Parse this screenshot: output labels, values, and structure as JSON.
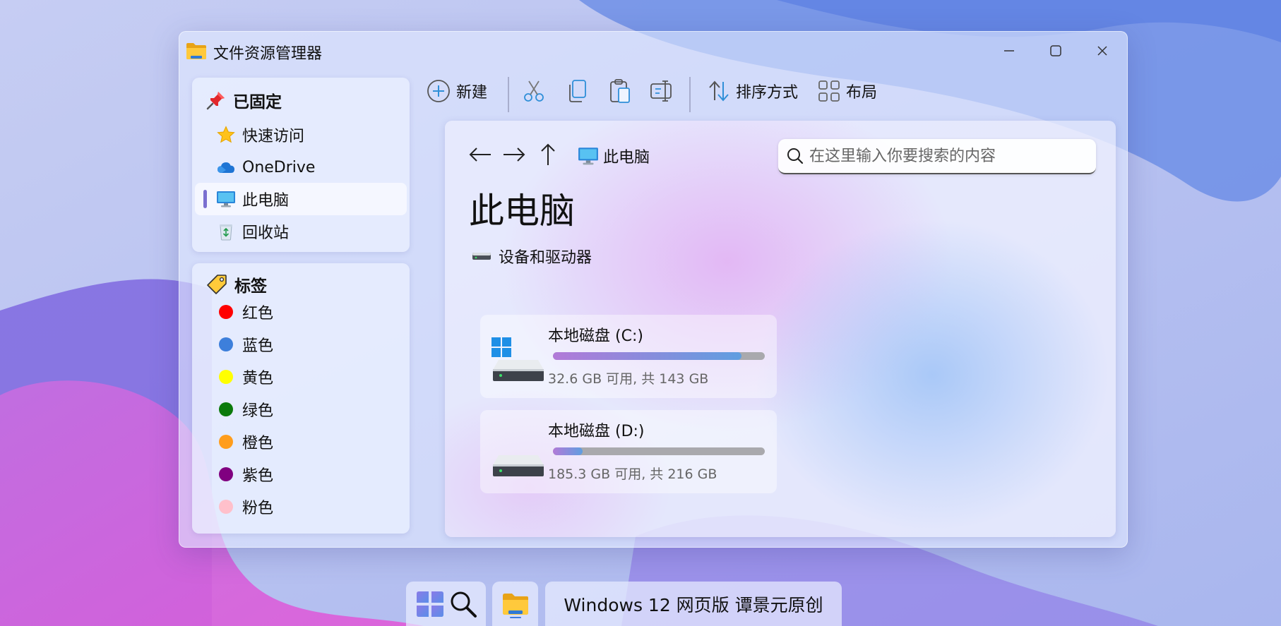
{
  "window": {
    "title": "文件资源管理器",
    "controls": {
      "minimize": "minimize",
      "maximize": "maximize",
      "close": "close"
    }
  },
  "sidebar": {
    "pinned_header": "已固定",
    "pinned_items": [
      {
        "label": "快速访问",
        "icon": "star-icon"
      },
      {
        "label": "OneDrive",
        "icon": "cloud-icon"
      },
      {
        "label": "此电脑",
        "icon": "monitor-icon",
        "active": true
      },
      {
        "label": "回收站",
        "icon": "recycle-bin-icon"
      }
    ],
    "tags_header": "标签",
    "tags": [
      {
        "label": "红色",
        "color": "#ff0000"
      },
      {
        "label": "蓝色",
        "color": "#3d7fdb"
      },
      {
        "label": "黄色",
        "color": "#ffff00"
      },
      {
        "label": "绿色",
        "color": "#0b7a0b"
      },
      {
        "label": "橙色",
        "color": "#ff9d1c"
      },
      {
        "label": "紫色",
        "color": "#800080"
      },
      {
        "label": "粉色",
        "color": "#ffc0cb"
      }
    ]
  },
  "toolbar": {
    "new_label": "新建",
    "sort_label": "排序方式",
    "layout_label": "布局"
  },
  "content": {
    "breadcrumb": "此电脑",
    "search_placeholder": "在这里输入你要搜索的内容",
    "page_title": "此电脑",
    "section_label": "设备和驱动器",
    "drives": [
      {
        "name": "本地磁盘 (C:)",
        "info": "32.6 GB 可用, 共 143 GB",
        "used_fraction": 0.89,
        "system": true
      },
      {
        "name": "本地磁盘 (D:)",
        "info": "185.3 GB 可用, 共 216 GB",
        "used_fraction": 0.14,
        "system": false
      }
    ]
  },
  "taskbar": {
    "brand_text": "Windows 12 网页版 谭景元原创"
  },
  "colors": {
    "accent": "#7a6fd0",
    "icon_blue": "#2f8fd8"
  }
}
